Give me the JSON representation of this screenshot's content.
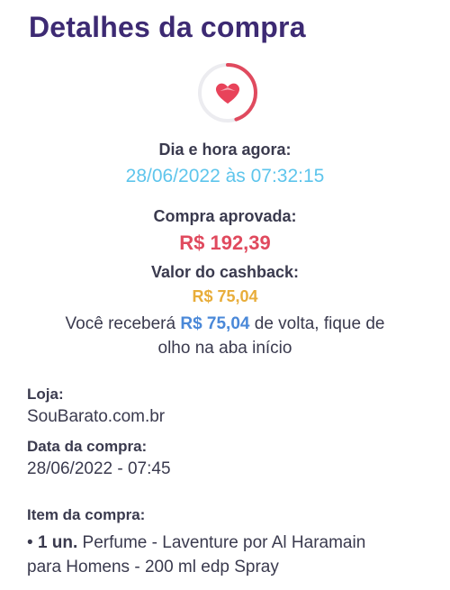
{
  "header": {
    "title": "Detalhes da compra"
  },
  "status_icon": {
    "name": "heart-icon",
    "ring_progress": 0.45,
    "accent": "#e04a5e"
  },
  "purchase": {
    "now_label": "Dia e hora agora:",
    "now_value": "28/06/2022 às 07:32:15",
    "approved_label": "Compra aprovada:",
    "approved_value": "R$ 192,39",
    "cashback_label": "Valor do cashback:",
    "cashback_value": "R$ 75,04",
    "message_pre": "Você receberá ",
    "message_amount": "R$ 75,04",
    "message_post_line1": " de volta, fique de",
    "message_line2": "olho na aba início"
  },
  "details": {
    "store_label": "Loja:",
    "store_value": "SouBarato.com.br",
    "date_label": "Data da compra:",
    "date_value": "28/06/2022 - 07:45",
    "item_label": "Item da compra:",
    "item_bullet": "• ",
    "item_qty": "1 un.",
    "item_desc_line1": " Perfume - Laventure por Al Haramain",
    "item_desc_line2": "para Homens - 200 ml edp Spray"
  },
  "colors": {
    "title": "#3d2a73",
    "date_now": "#5ec5ec",
    "amount": "#e04a5e",
    "cashback": "#e8ad3a",
    "highlight": "#4a88d8"
  }
}
